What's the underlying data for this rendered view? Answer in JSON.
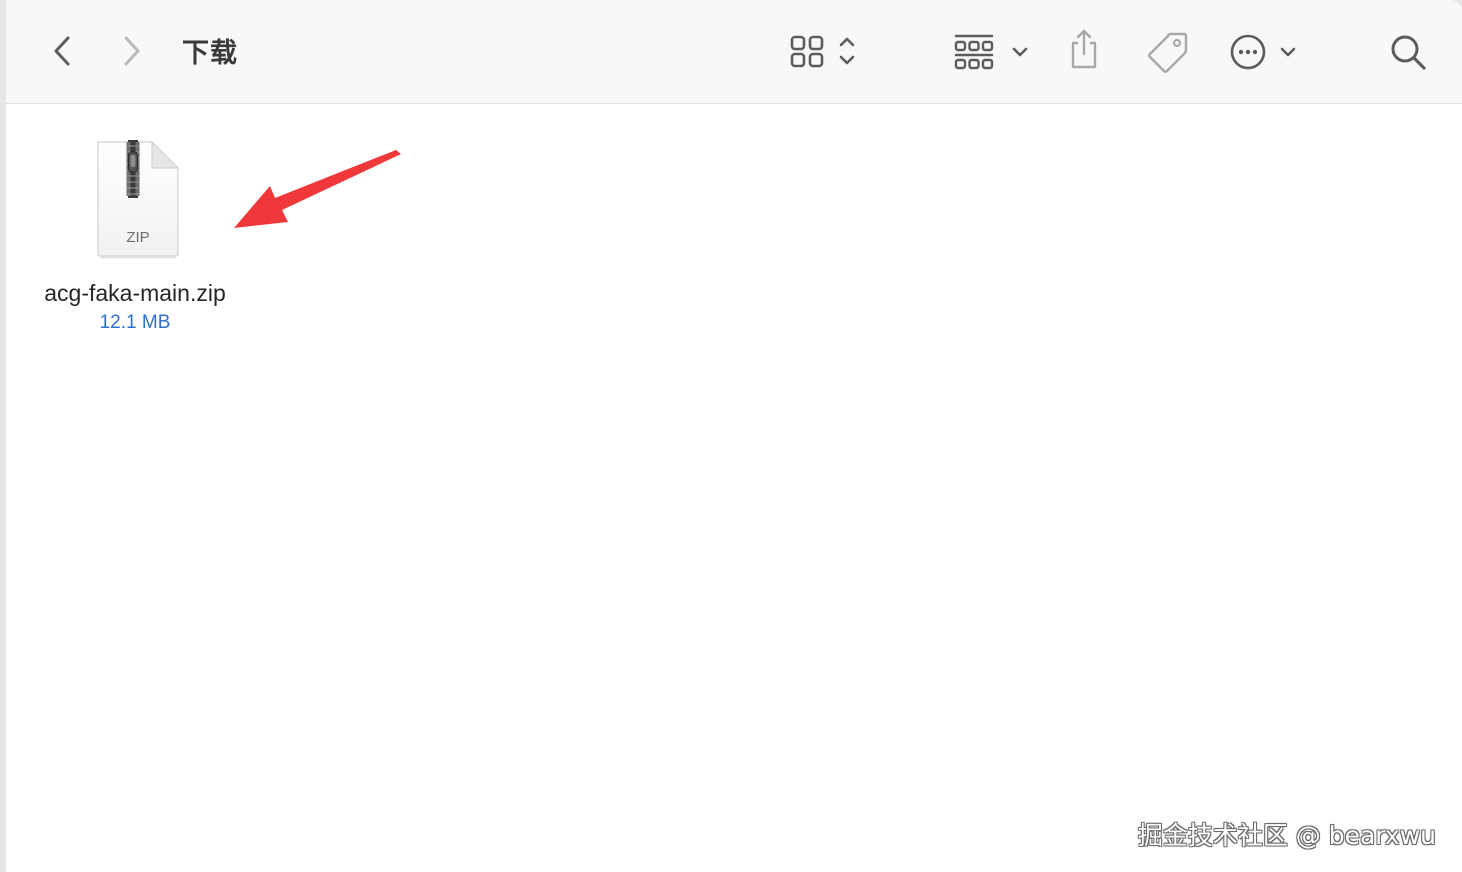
{
  "window": {
    "title": "下载"
  },
  "toolbar": {
    "back_icon": "chevron-left-icon",
    "forward_icon": "chevron-right-icon",
    "view_icon": "grid-view-icon",
    "group_icon": "group-by-icon",
    "share_icon": "share-icon",
    "tag_icon": "tag-icon",
    "more_icon": "more-actions-icon",
    "search_icon": "search-icon"
  },
  "files": [
    {
      "name": "acg-faka-main.zip",
      "size": "12.1 MB",
      "icon_label": "ZIP"
    }
  ],
  "annotation": {
    "arrow_color": "#f0383b"
  },
  "watermark": "掘金技术社区 @ bearxwu",
  "colors": {
    "accent_text": "#2f6fcd",
    "toolbar_icon": "#5f5f5f"
  }
}
